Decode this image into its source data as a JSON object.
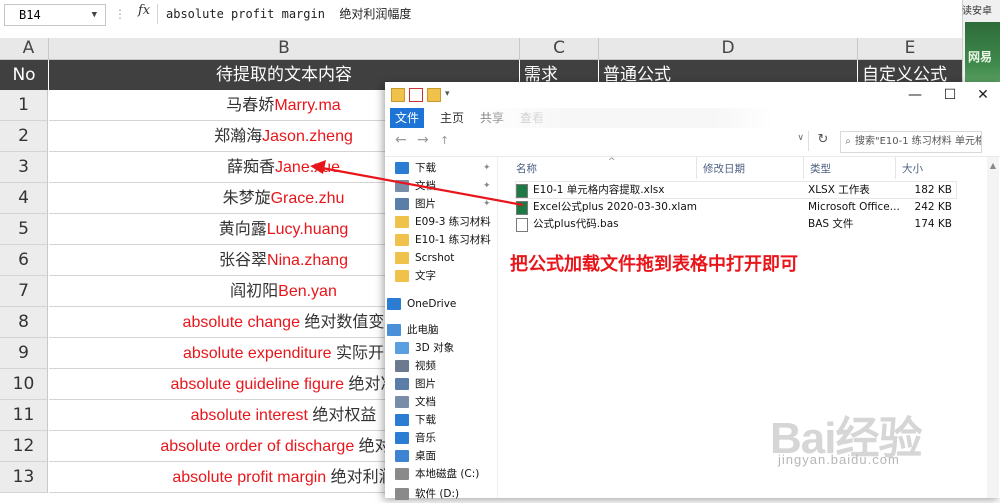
{
  "formula_bar": {
    "name_box": "B14",
    "fx": "fx",
    "formula": "absolute profit margin  绝对利润幅度"
  },
  "sheet": {
    "columns": [
      "A",
      "B",
      "C",
      "D",
      "E"
    ],
    "header_row": {
      "no": "No",
      "b": "待提取的文本内容",
      "c": "需求",
      "d": "普通公式",
      "e": "自定义公式"
    },
    "rows": [
      {
        "n": "1",
        "cn": "马春娇",
        "en": "Marry.ma"
      },
      {
        "n": "2",
        "cn": "郑瀚海",
        "en": "Jason.zheng"
      },
      {
        "n": "3",
        "cn": "薛痴香",
        "en": "Jane.xue"
      },
      {
        "n": "4",
        "cn": "朱梦旋",
        "en": "Grace.zhu"
      },
      {
        "n": "5",
        "cn": "黄向露",
        "en": "Lucy.huang"
      },
      {
        "n": "6",
        "cn": "张谷翠",
        "en": "Nina.zhang"
      },
      {
        "n": "7",
        "cn": "阎初阳",
        "en": "Ben.yan"
      },
      {
        "n": "8",
        "en": "absolute change ",
        "cn": "绝对数值变"
      },
      {
        "n": "9",
        "en": "absolute expenditure ",
        "cn": "实际开"
      },
      {
        "n": "10",
        "en": "absolute guideline figure ",
        "cn": "绝对准"
      },
      {
        "n": "11",
        "en": "absolute interest ",
        "cn": "绝对权益"
      },
      {
        "n": "12",
        "en": "absolute order of discharge ",
        "cn": "绝对破"
      },
      {
        "n": "13",
        "en": "absolute profit margin ",
        "cn": "绝对利润"
      }
    ]
  },
  "side_strip": {
    "top_text": "读安卓",
    "thumb_text": "网易"
  },
  "explorer": {
    "window_controls": {
      "minimize": "—",
      "maximize": "☐",
      "close": "✕"
    },
    "tabs": {
      "file": "文件",
      "home": "主页",
      "share": "共享",
      "view": "查看"
    },
    "search_placeholder": "搜索\"E10-1 练习材料 单元格...",
    "nav_items": [
      {
        "label": "下载",
        "icon": "download-icon",
        "color": "#2b7cd3",
        "pinned": true
      },
      {
        "label": "文档",
        "icon": "document-icon",
        "color": "#7a8da8",
        "pinned": true
      },
      {
        "label": "图片",
        "icon": "pictures-icon",
        "color": "#5a7ea8",
        "pinned": true
      },
      {
        "label": "E09-3 练习材料",
        "icon": "folder-icon",
        "color": "#f0c24b",
        "pinned": false
      },
      {
        "label": "E10-1 练习材料",
        "icon": "folder-icon",
        "color": "#f0c24b",
        "pinned": false
      },
      {
        "label": "Scrshot",
        "icon": "folder-icon",
        "color": "#f0c24b",
        "pinned": false
      },
      {
        "label": "文字",
        "icon": "folder-icon",
        "color": "#f0c24b",
        "pinned": false
      },
      {
        "label": "OneDrive",
        "icon": "cloud-icon",
        "color": "#2b7cd3",
        "pinned": false
      },
      {
        "label": "此电脑",
        "icon": "computer-icon",
        "color": "#4a90d9",
        "pinned": false
      },
      {
        "label": "3D 对象",
        "icon": "3d-objects-icon",
        "color": "#5aa0e0",
        "pinned": false
      },
      {
        "label": "视频",
        "icon": "video-icon",
        "color": "#6b7a8f",
        "pinned": false
      },
      {
        "label": "图片",
        "icon": "pictures-icon",
        "color": "#5a7ea8",
        "pinned": false
      },
      {
        "label": "文档",
        "icon": "document-icon",
        "color": "#7a8da8",
        "pinned": false
      },
      {
        "label": "下载",
        "icon": "download-icon",
        "color": "#2b7cd3",
        "pinned": false
      },
      {
        "label": "音乐",
        "icon": "music-icon",
        "color": "#2b7cd3",
        "pinned": false
      },
      {
        "label": "桌面",
        "icon": "desktop-icon",
        "color": "#3f84d2",
        "pinned": false
      },
      {
        "label": "本地磁盘 (C:)",
        "icon": "drive-icon",
        "color": "#8a8a8a",
        "pinned": false
      },
      {
        "label": "软件 (D:)",
        "icon": "drive-icon",
        "color": "#8a8a8a",
        "pinned": false
      }
    ],
    "columns": {
      "name": "名称",
      "modified": "修改日期",
      "type": "类型",
      "size": "大小"
    },
    "files": [
      {
        "name": "E10-1 单元格内容提取.xlsx",
        "type": "XLSX 工作表",
        "size": "182 KB",
        "icon_color": "#1d7a44"
      },
      {
        "name": "Excel公式plus 2020-03-30.xlam",
        "type": "Microsoft Office...",
        "size": "242 KB",
        "icon_color": "#1d7a44"
      },
      {
        "name": "公式plus代码.bas",
        "type": "BAS 文件",
        "size": "174 KB",
        "icon_color": "#ffffff"
      }
    ]
  },
  "annotation": "把公式加载文件拖到表格中打开即可",
  "watermark": {
    "logo": "Bai经验",
    "url": "jingyan.baidu.com"
  },
  "colors": {
    "red_text": "#e8161b",
    "header_bg": "#404040",
    "ribbon_file": "#1e73d6"
  }
}
